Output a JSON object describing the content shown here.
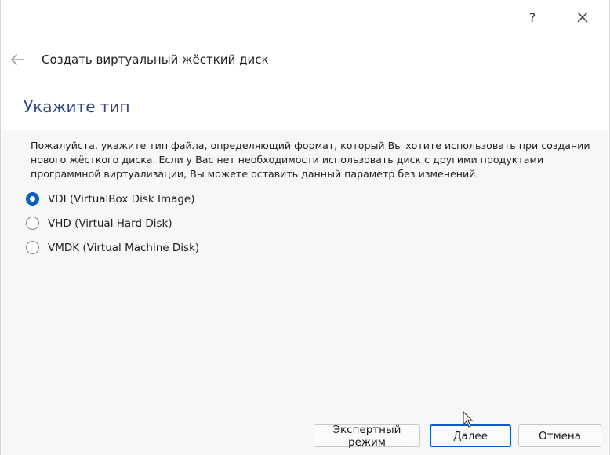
{
  "titlebar": {
    "help_label": "?"
  },
  "wizard": {
    "title": "Создать виртуальный жёсткий диск"
  },
  "page": {
    "heading": "Укажите тип",
    "description": "Пожалуйста, укажите тип файла, определяющий формат, который Вы хотите использовать при создании нового жёсткого диска. Если у Вас нет необходимости использовать диск с другими продуктами программной виртуализации, Вы можете оставить данный параметр без изменений."
  },
  "options": [
    {
      "label": "VDI (VirtualBox Disk Image)",
      "checked": true
    },
    {
      "label": "VHD (Virtual Hard Disk)",
      "checked": false
    },
    {
      "label": "VMDK (Virtual Machine Disk)",
      "checked": false
    }
  ],
  "buttons": {
    "expert": "Экспертный режим",
    "next": "Далее",
    "cancel": "Отмена"
  },
  "colors": {
    "accent": "#0b5cc8",
    "heading": "#2b4a85"
  },
  "icons": {
    "help": "help-icon",
    "close": "close-icon",
    "back": "back-arrow-icon",
    "cursor": "mouse-cursor-icon"
  }
}
